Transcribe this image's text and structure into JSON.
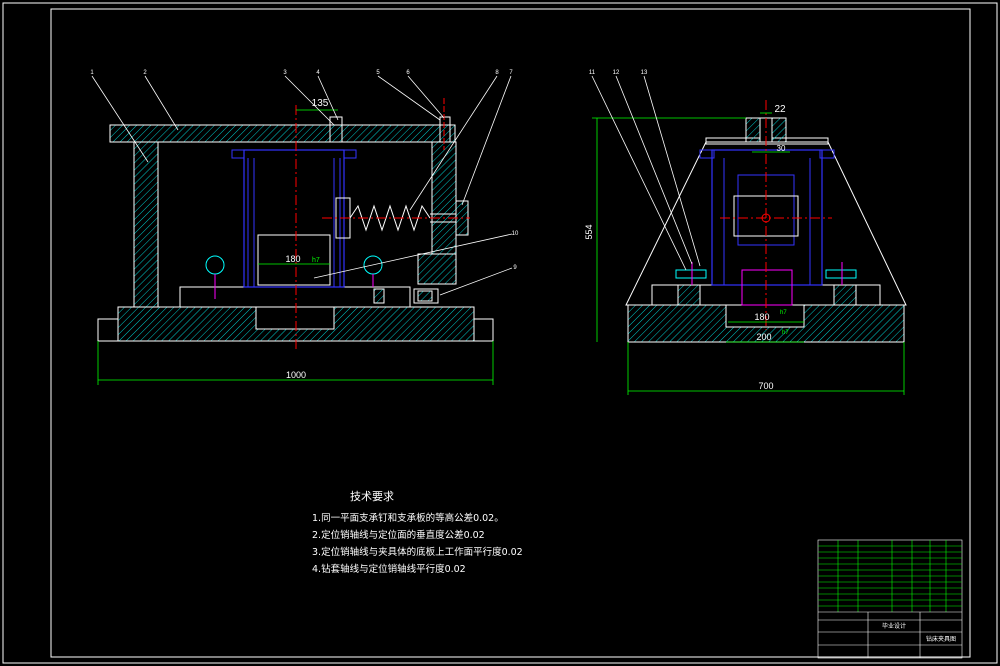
{
  "colors": {
    "background": "#000000",
    "frame": "#ffffff",
    "part_outline": "#ffffff",
    "hatch": "#00ffff",
    "fixture_blue": "#3333ff",
    "magenta": "#ff00ff",
    "centerline": "#ff0000",
    "dimension": "#00ff00",
    "dimension_text": "#ffffff",
    "leader": "#ffffff"
  },
  "left_view": {
    "dim_overall_width": "1000",
    "dim_top_offset": "135",
    "dim_inner": "180",
    "dim_inner_tol": "h7",
    "balloons": [
      "1",
      "2",
      "3",
      "4",
      "5",
      "6",
      "8",
      "7",
      "10",
      "9"
    ]
  },
  "right_view": {
    "dim_overall_width": "700",
    "dim_height": "554",
    "dim_top": "22",
    "dim_top2": "30",
    "dim_bore": "180",
    "dim_base": "200",
    "dim_tol": "h7",
    "balloons": [
      "11",
      "12",
      "13"
    ]
  },
  "tech_requirements": {
    "title": "技术要求",
    "items": [
      "1.同一平面支承钉和支承板的等高公差0.02。",
      "2.定位销轴线与定位面的垂直度公差0.02",
      "3.定位销轴线与夹具体的底板上工作面平行度0.02",
      "4.钻套轴线与定位销轴线平行度0.02"
    ]
  },
  "title_block": {
    "label_drawing": "钻床夹具图",
    "label_company": "毕业设计"
  }
}
